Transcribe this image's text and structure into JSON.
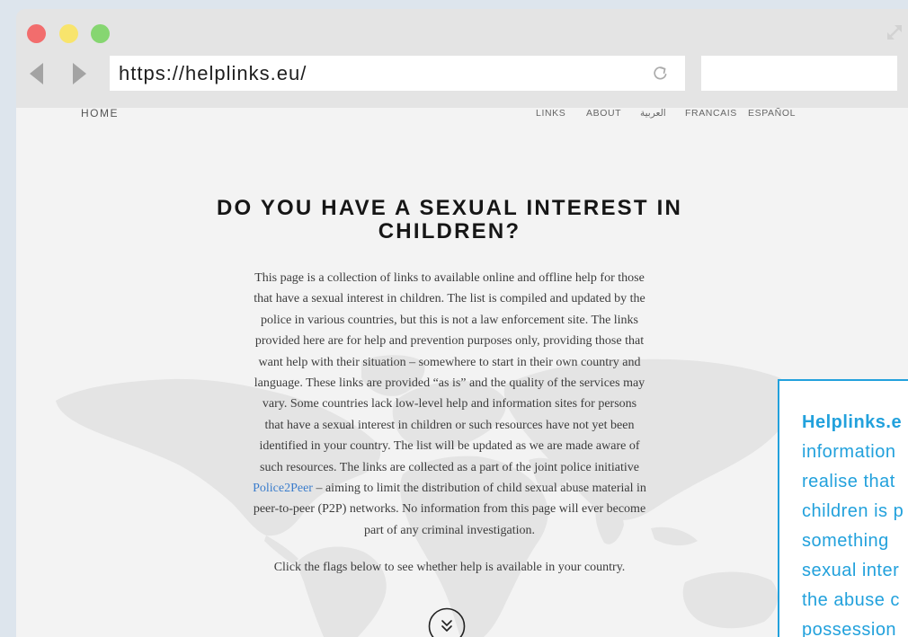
{
  "browser": {
    "url": "https://helplinks.eu/",
    "icons": {
      "back": "back-arrow-icon",
      "forward": "forward-arrow-icon",
      "reload": "reload-icon",
      "expand": "expand-icon"
    },
    "traffic_lights": {
      "close": "#f26d6d",
      "minimize": "#f8e46c",
      "zoom": "#86d671"
    }
  },
  "nav": {
    "home": "HOME",
    "links": "LINKS",
    "about": "ABOUT",
    "arabic": "العربية",
    "french": "FRANCAIS",
    "spanish": "ESPAÑOL"
  },
  "hero": {
    "title_lines": [
      "DO YOU HAVE A SEXUAL INTEREST IN",
      "CHILDREN?"
    ],
    "intro_lines": [
      {
        "text": "This page is a collection of links to available online and offline help for those"
      },
      {
        "text": "that have a sexual interest in children. The list is compiled and updated by the"
      },
      {
        "text": "police in various countries, but this is not a law enforcement site. The links"
      },
      {
        "text": "provided here are for help and prevention purposes only, providing those that"
      },
      {
        "text": "want help with their situation – somewhere to start in their own country and"
      },
      {
        "text": "language. These links are provided “as is” and the quality of the services may"
      },
      {
        "text": "vary. Some countries lack low-level help and information sites for persons"
      },
      {
        "text": "that have a sexual interest in children or such resources have not yet been"
      },
      {
        "text": "identified in your country. The list will be updated as we are made aware of"
      },
      {
        "text": "such resources. The links are collected as a part of the joint police initiative"
      },
      {
        "link": "Police2Peer",
        "text": " – aiming to limit the distribution of child sexual abuse material in"
      },
      {
        "text": "peer-to-peer (P2P) networks. No information from this page will ever become"
      },
      {
        "text": "part of any criminal investigation."
      }
    ],
    "flags_prompt": "Click the flags below to see whether help is available in your country.",
    "scroll_icon": "double-chevron-down-icon"
  },
  "callout": {
    "lines": [
      "Helplinks.e",
      "information",
      "realise that",
      "children is p",
      "something",
      "sexual inter",
      "the abuse c",
      "possession"
    ]
  },
  "colors": {
    "page_background": "#dde5ed",
    "link": "#3b7dcc",
    "callout_accent": "#22a1dc"
  }
}
